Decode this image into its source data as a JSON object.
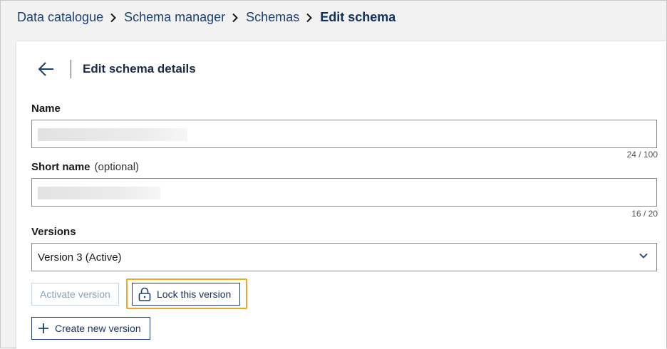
{
  "breadcrumb": {
    "items": [
      "Data catalogue",
      "Schema manager",
      "Schemas"
    ],
    "current": "Edit schema"
  },
  "header": {
    "title": "Edit schema details"
  },
  "form": {
    "name": {
      "label": "Name",
      "counter": "24 / 100"
    },
    "short_name": {
      "label": "Short name",
      "optional": "(optional)",
      "counter": "16 / 20"
    },
    "versions": {
      "label": "Versions",
      "selected": "Version 3 (Active)"
    }
  },
  "actions": {
    "activate_label": "Activate version",
    "lock_label": "Lock this version",
    "create_label": "Create new version"
  },
  "colors": {
    "accent": "#1c3f73",
    "highlight": "#e8a92c",
    "disabled": "#8aa0b8"
  }
}
